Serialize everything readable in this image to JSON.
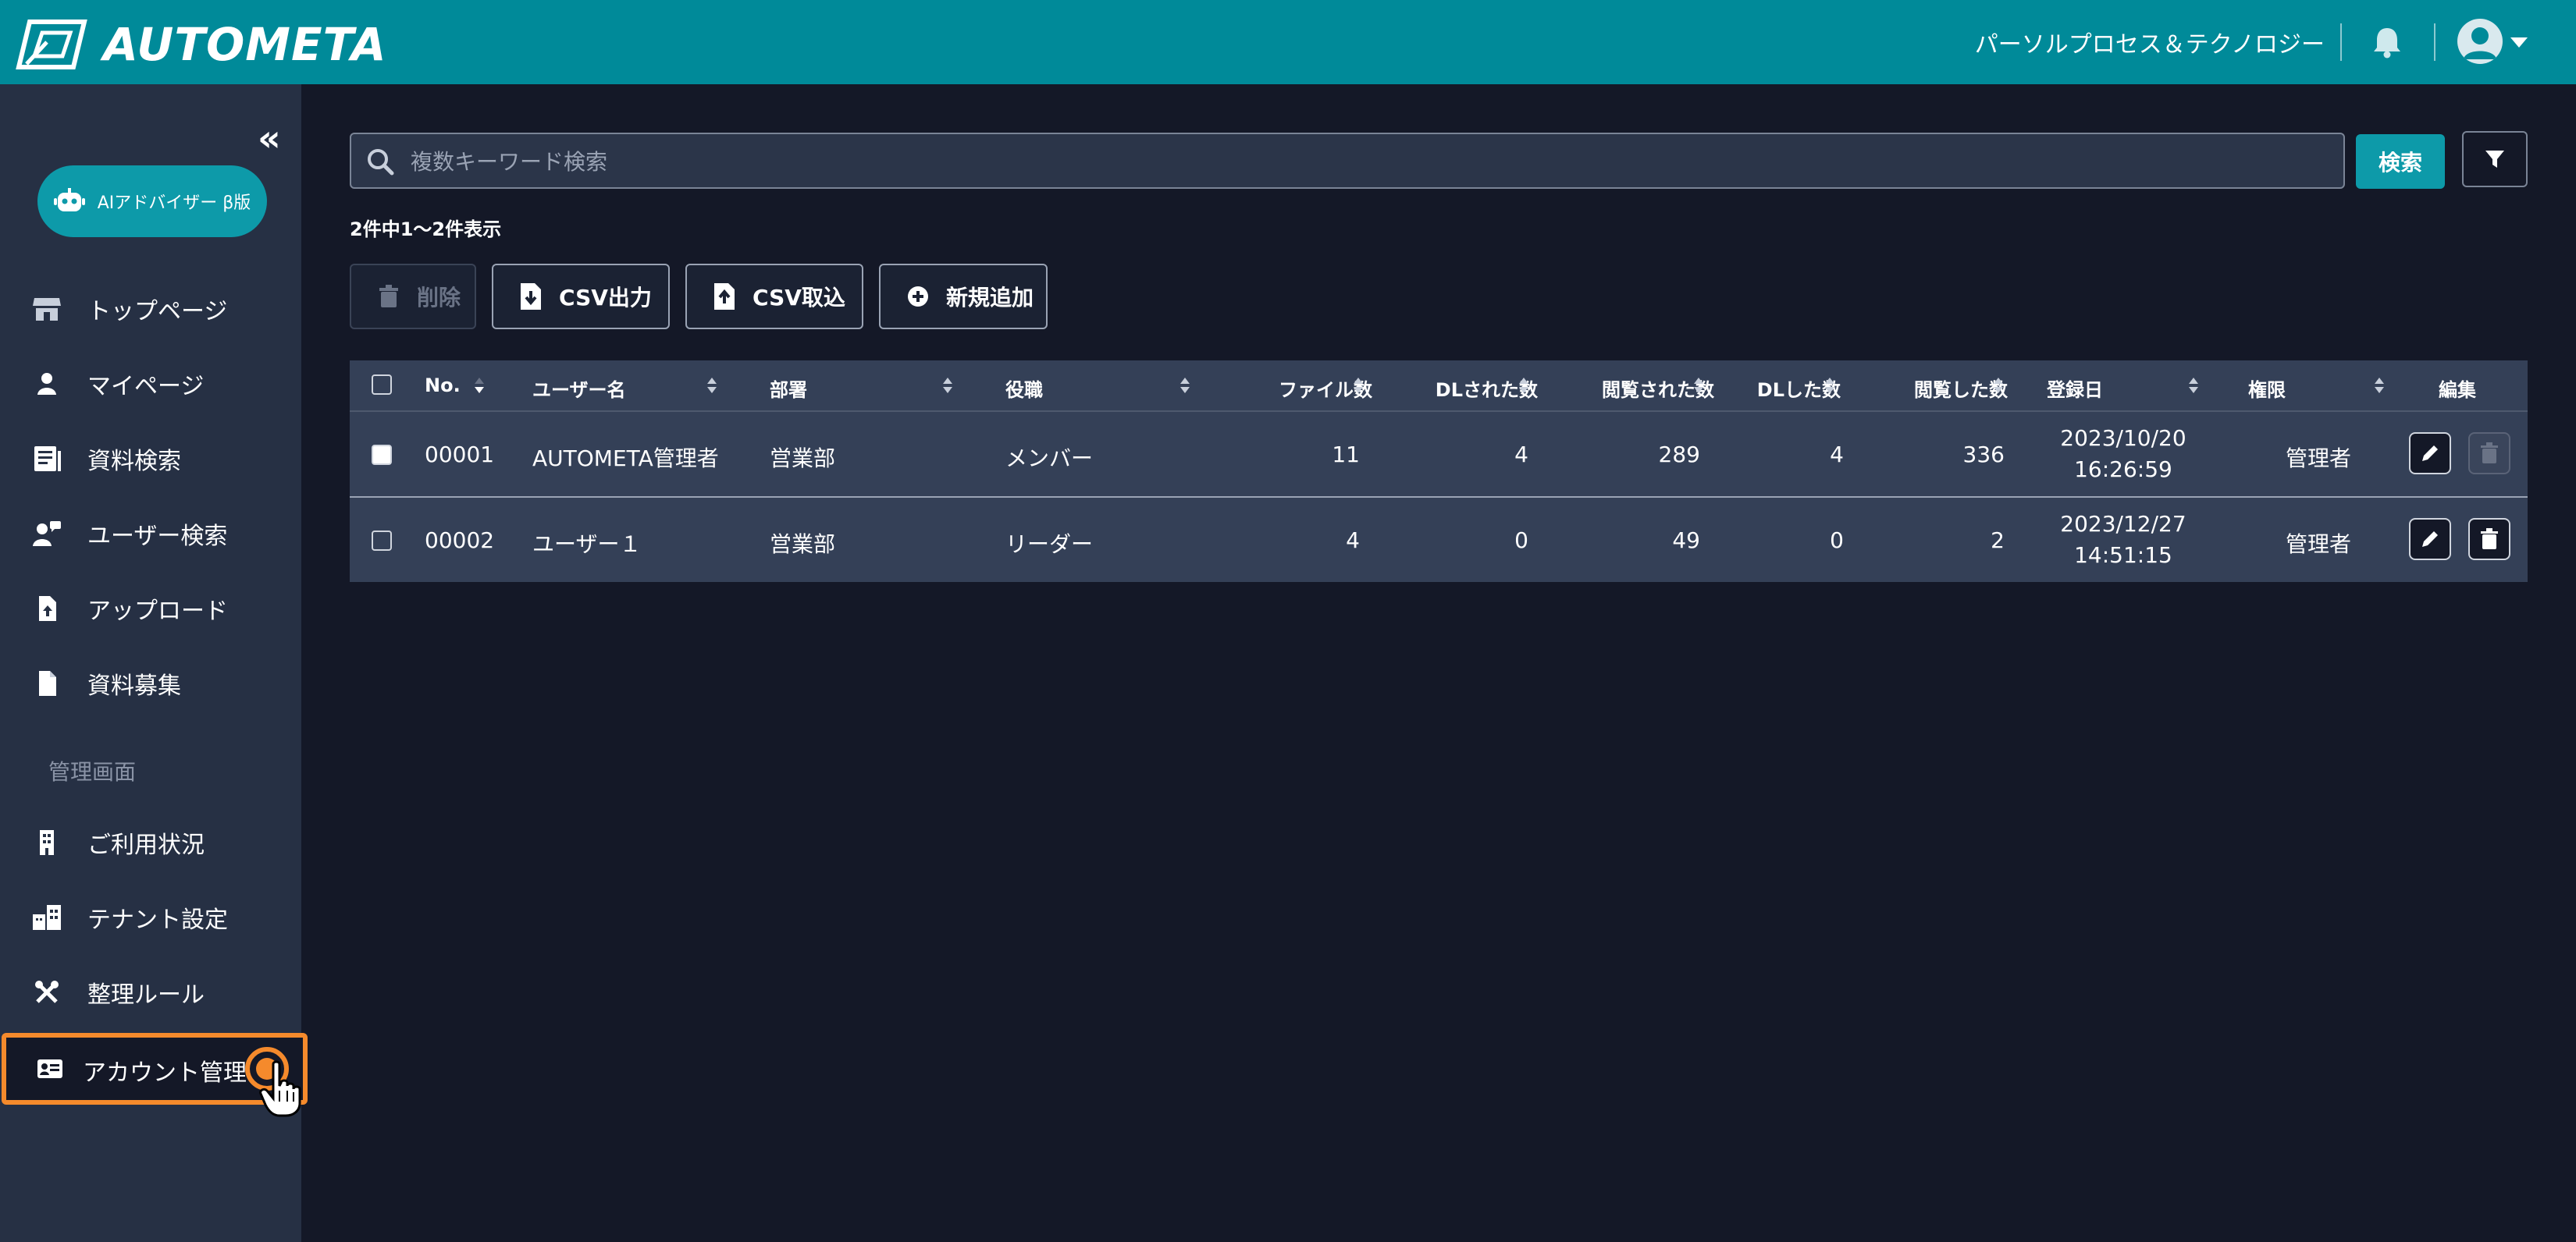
{
  "header": {
    "logo_text": "AUTOMETA",
    "company": "パーソルプロセス＆テクノロジー"
  },
  "sidebar": {
    "ai_button": "AIアドバイザー β版",
    "items": [
      {
        "label": "トップページ",
        "icon": "store-icon"
      },
      {
        "label": "マイページ",
        "icon": "user-icon"
      },
      {
        "label": "資料検索",
        "icon": "document-list-icon"
      },
      {
        "label": "ユーザー検索",
        "icon": "user-search-icon"
      },
      {
        "label": "アップロード",
        "icon": "file-upload-icon"
      },
      {
        "label": "資料募集",
        "icon": "file-icon"
      }
    ],
    "admin_section_label": "管理画面",
    "admin_items": [
      {
        "label": "ご利用状況",
        "icon": "building-icon"
      },
      {
        "label": "テナント設定",
        "icon": "tenant-icon"
      },
      {
        "label": "整理ルール",
        "icon": "tools-icon"
      },
      {
        "label": "アカウント管理",
        "icon": "id-card-icon",
        "active": true
      }
    ]
  },
  "search": {
    "placeholder": "複数キーワード検索",
    "value": "",
    "button_label": "検索"
  },
  "result_count": "2件中1〜2件表示",
  "actions": {
    "delete": "削除",
    "csv_export": "CSV出力",
    "csv_import": "CSV取込",
    "add_new": "新規追加"
  },
  "table": {
    "columns": [
      "No.",
      "ユーザー名",
      "部署",
      "役職",
      "ファイル数",
      "DLされた数",
      "閲覧された数",
      "DLした数",
      "閲覧した数",
      "登録日",
      "権限",
      "編集"
    ],
    "rows": [
      {
        "no": "00001",
        "username": "AUTOMETA管理者",
        "dept": "営業部",
        "position": "メンバー",
        "files": "11",
        "dl_received": "4",
        "views_received": "289",
        "dl_done": "4",
        "views_done": "336",
        "date": "2023/10/20",
        "time": "16:26:59",
        "role": "管理者",
        "checked": true
      },
      {
        "no": "00002",
        "username": "ユーザー１",
        "dept": "営業部",
        "position": "リーダー",
        "files": "4",
        "dl_received": "0",
        "views_received": "49",
        "dl_done": "0",
        "views_done": "2",
        "date": "2023/12/27",
        "time": "14:51:15",
        "role": "管理者",
        "checked": false
      }
    ]
  },
  "colors": {
    "header": "#008a99",
    "accent": "#0d9aa9",
    "background": "#141827",
    "sidebar": "#263044",
    "highlight": "#f58a2c"
  }
}
